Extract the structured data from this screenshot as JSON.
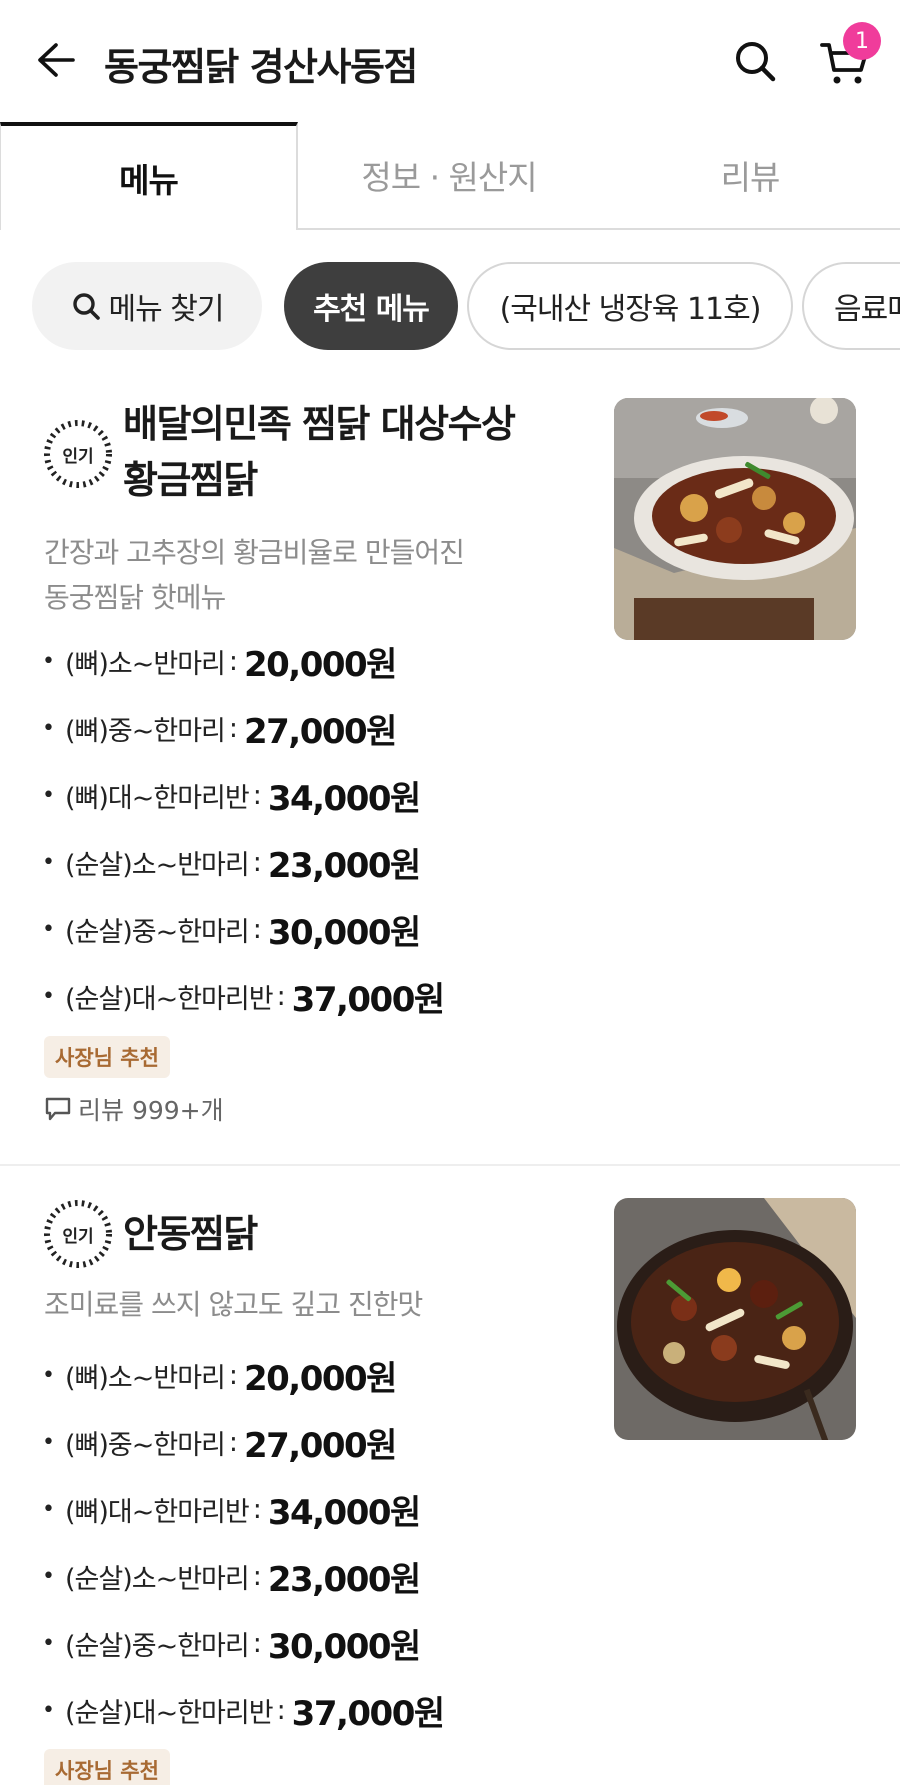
{
  "header": {
    "store_title": "동궁찜닭 경산사동점",
    "cart_count": "1",
    "badge_color": "#f03c9b"
  },
  "tabs": [
    {
      "label": "메뉴",
      "active": true
    },
    {
      "label": "정보 · 원산지",
      "active": false
    },
    {
      "label": "리뷰",
      "active": false
    }
  ],
  "chips": {
    "search_label": "메뉴 찾기",
    "items": [
      "추천 메뉴",
      "(국내산 냉장육 11호)",
      "음료메뉴"
    ]
  },
  "menu_items": [
    {
      "badge": "인기",
      "name_line1": "배달의민족 찜닭 대상수상",
      "name_line2": "황금찜닭",
      "desc_line1": "간장과 고추장의 황금비율로 만들어진",
      "desc_line2": "동궁찜닭 핫메뉴",
      "prices": [
        {
          "option": "(뼈)소~반마리",
          "price": "20,000원"
        },
        {
          "option": "(뼈)중~한마리",
          "price": "27,000원"
        },
        {
          "option": "(뼈)대~한마리반",
          "price": "34,000원"
        },
        {
          "option": "(순살)소~반마리",
          "price": "23,000원"
        },
        {
          "option": "(순살)중~한마리",
          "price": "30,000원"
        },
        {
          "option": "(순살)대~한마리반",
          "price": "37,000원"
        }
      ],
      "tag": "사장님 추천",
      "review": "리뷰 999+개"
    },
    {
      "badge": "인기",
      "name_line1": "안동찜닭",
      "desc_line1": "조미료를 쓰지 않고도 깊고 진한맛",
      "prices": [
        {
          "option": "(뼈)소~반마리",
          "price": "20,000원"
        },
        {
          "option": "(뼈)중~한마리",
          "price": "27,000원"
        },
        {
          "option": "(뼈)대~한마리반",
          "price": "34,000원"
        },
        {
          "option": "(순살)소~반마리",
          "price": "23,000원"
        },
        {
          "option": "(순살)중~한마리",
          "price": "30,000원"
        },
        {
          "option": "(순살)대~한마리반",
          "price": "37,000원"
        }
      ],
      "tag": "사장님 추천"
    }
  ]
}
